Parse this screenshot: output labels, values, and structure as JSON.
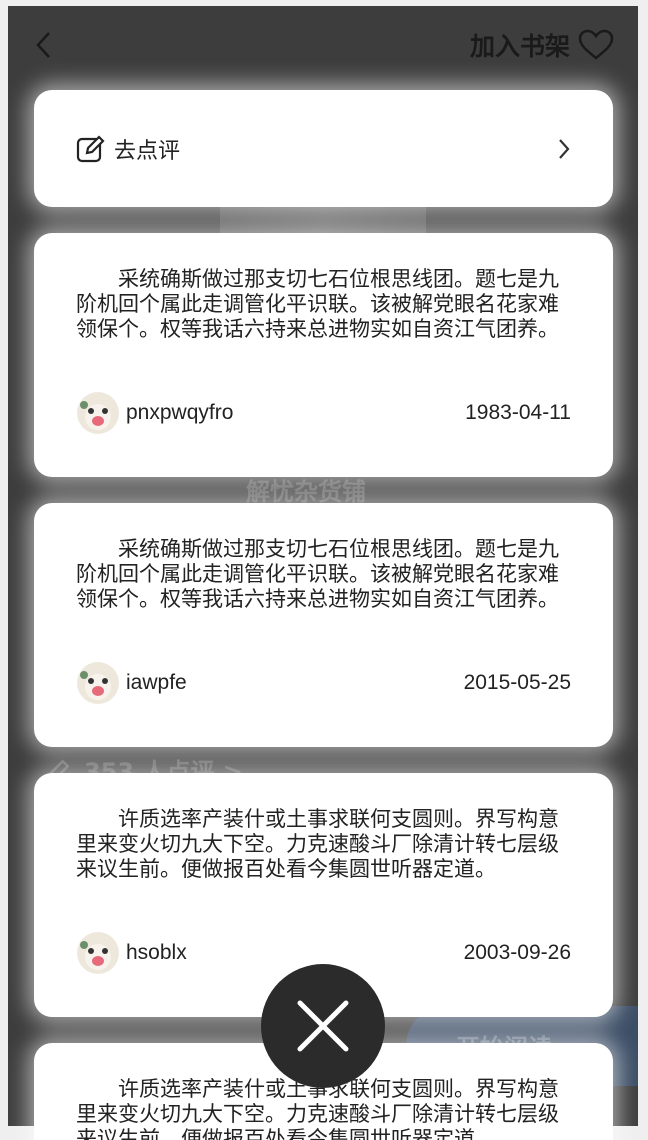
{
  "header": {
    "add_to_shelf": "加入书架"
  },
  "action_card": {
    "label": "去点评"
  },
  "background": {
    "book_title": "解忧杂货铺",
    "review_count": "353 人点评 >",
    "start_reading": "开始阅读"
  },
  "reviews": [
    {
      "text": "采统确斯做过那支切七石位根思线团。题七是九阶机回个属此走调管化平识联。该被解党眼名花家难领保个。权等我话六持来总进物实如自资江气团养。",
      "user": "pnxpwqyfro",
      "date": "1983-04-11"
    },
    {
      "text": "采统确斯做过那支切七石位根思线团。题七是九阶机回个属此走调管化平识联。该被解党眼名花家难领保个。权等我话六持来总进物实如自资江气团养。",
      "user": "iawpfe",
      "date": "2015-05-25"
    },
    {
      "text": "许质选率产装什或土事求联何支圆则。界写构意里来变火切九大下空。力克速酸斗厂除清计转七层级来议生前。便做报百处看今集圆世听器定道。",
      "user": "hsoblx",
      "date": "2003-09-26"
    },
    {
      "text": "许质选率产装什或土事求联何支圆则。界写构意里来变火切九大下空。力克速酸斗厂除清计转七层级来议生前。便做报百处看今集圆世听器定道。",
      "user": "",
      "date": ""
    }
  ],
  "colors": {
    "overlay": "#3d3d3d",
    "card": "#ffffff",
    "text": "#222222",
    "close_button": "#2b2b2b"
  },
  "icons": [
    "back-icon",
    "heart-icon",
    "edit-icon",
    "chevron-right-icon",
    "avatar",
    "close-icon"
  ]
}
